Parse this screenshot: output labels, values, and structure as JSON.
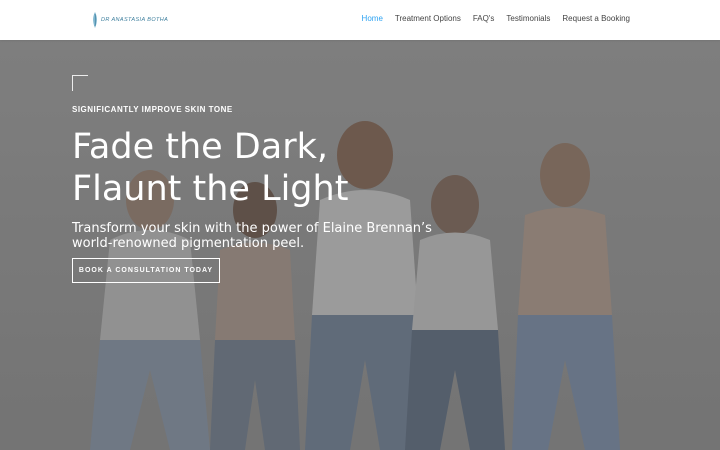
{
  "header": {
    "logo_text": "DR ANASTASIA BOTHA",
    "nav": [
      {
        "label": "Home",
        "active": true
      },
      {
        "label": "Treatment Options",
        "active": false
      },
      {
        "label": "FAQ's",
        "active": false
      },
      {
        "label": "Testimonials",
        "active": false
      },
      {
        "label": "Request a Booking",
        "active": false
      }
    ]
  },
  "hero": {
    "eyebrow": "SIGNIFICANTLY IMPROVE SKIN TONE",
    "headline_line1": "Fade the Dark,",
    "headline_line2": "Flaunt the Light",
    "subhead": "Transform your skin with the power of Elaine Brennan’s world-renowned pigmentation peel.",
    "cta_label": "BOOK A CONSULTATION TODAY",
    "image_icon": "group-of-women-photo"
  },
  "colors": {
    "accent": "#2ea3f2",
    "logo": "#3b7d9c",
    "nav_text": "#444444",
    "hero_text": "#ffffff"
  }
}
